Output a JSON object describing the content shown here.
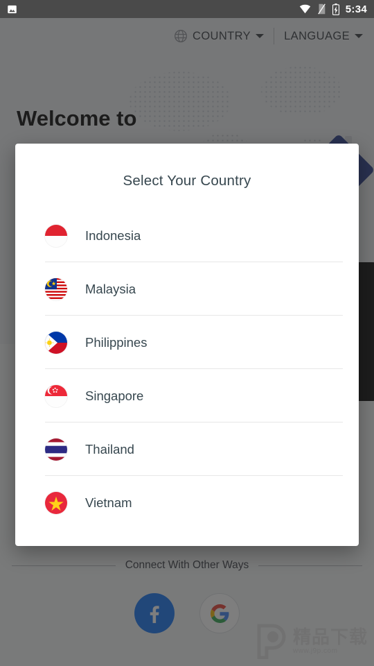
{
  "statusbar": {
    "time": "5:34",
    "icons": [
      "image-notification-icon",
      "wifi-icon",
      "no-sim-icon",
      "battery-charging-icon"
    ]
  },
  "background": {
    "topbar": {
      "country_label": "COUNTRY",
      "language_label": "LANGUAGE"
    },
    "welcome_heading": "Welcome to",
    "connect_label": "Connect With Other Ways",
    "social": [
      {
        "name": "facebook",
        "label": "f"
      },
      {
        "name": "google",
        "label": "G"
      }
    ],
    "watermark": {
      "text": "精品下载",
      "url": "www.j9p.com"
    }
  },
  "dialog": {
    "title": "Select Your Country",
    "countries": [
      {
        "name": "Indonesia",
        "flag": "indonesia-flag-icon"
      },
      {
        "name": "Malaysia",
        "flag": "malaysia-flag-icon"
      },
      {
        "name": "Philippines",
        "flag": "philippines-flag-icon"
      },
      {
        "name": "Singapore",
        "flag": "singapore-flag-icon"
      },
      {
        "name": "Thailand",
        "flag": "thailand-flag-icon"
      },
      {
        "name": "Vietnam",
        "flag": "vietnam-flag-icon"
      }
    ]
  },
  "colors": {
    "scrim": "#282828",
    "dialog_bg": "#ffffff",
    "title_text": "#37474f",
    "divider": "#e7e7e7",
    "facebook_blue": "#1877f2",
    "flag_red": "#e02330",
    "thai_blue": "#2d2a83",
    "vietnam_red": "#e8283c",
    "vietnam_star": "#ffd119"
  }
}
